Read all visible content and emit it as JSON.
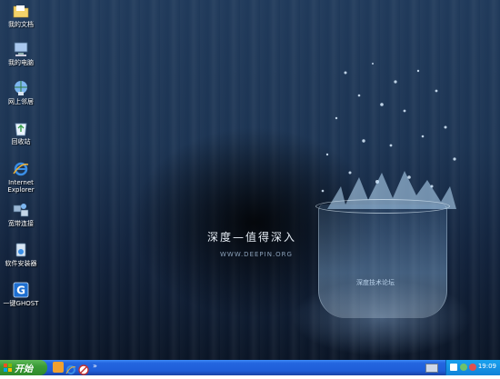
{
  "desktop": {
    "icons": [
      {
        "label": "我的文档",
        "icon": "folder-icon",
        "color": "#f3d36a"
      },
      {
        "label": "我的电脑",
        "icon": "computer-icon",
        "color": "#a9c8ee"
      },
      {
        "label": "网上邻居",
        "icon": "network-icon",
        "color": "#7db6f0"
      },
      {
        "label": "回收站",
        "icon": "recycle-bin-icon",
        "color": "#6fc97a"
      },
      {
        "label": "Internet Explorer",
        "icon": "ie-icon",
        "color": "#3a8ee6"
      },
      {
        "label": "宽带连接",
        "icon": "broadband-icon",
        "color": "#9ab7d4"
      },
      {
        "label": "软件安装器",
        "icon": "installer-icon",
        "color": "#d6e4f2"
      },
      {
        "label": "一键GHOST",
        "icon": "ghost-icon",
        "color": "#1e6fd0"
      }
    ],
    "wallpaper": {
      "tagline": "深度—值得深入",
      "url": "WWW.DEEPIN.ORG",
      "forum": "深度技术论坛"
    }
  },
  "taskbar": {
    "start_label": "开始",
    "quicklaunch": [
      {
        "icon": "show-desktop-icon",
        "color": "#f0a030"
      },
      {
        "icon": "ie-quicklaunch-icon",
        "color": "#3a8ee6"
      },
      {
        "icon": "no-entry-icon",
        "color": "#e0e0e0"
      }
    ],
    "chevron": "»",
    "clock": "19:09"
  }
}
